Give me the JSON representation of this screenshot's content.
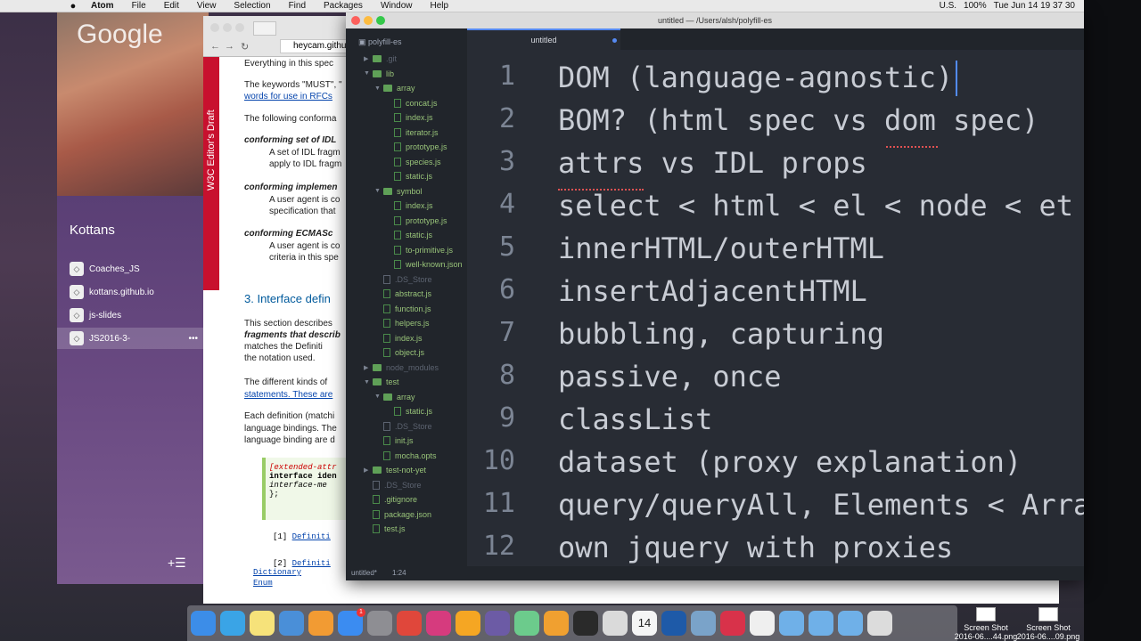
{
  "menubar": {
    "apple": "",
    "items": [
      "Atom",
      "File",
      "Edit",
      "View",
      "Selection",
      "Find",
      "Packages",
      "Window",
      "Help"
    ],
    "status": {
      "input_source": "U.S.",
      "battery": "100%",
      "datetime": "Tue Jun 14 19 37 30"
    }
  },
  "desktop": {
    "google_text": "Google"
  },
  "slack": {
    "team": "Kottans",
    "channels": [
      "Coaches_JS",
      "kottans.github.io",
      "js-slides",
      "JS2016-3-"
    ],
    "more": "•••",
    "add": "+☰"
  },
  "browser": {
    "url": "heycam.githu",
    "badge_text": "W3C Editor's Draft",
    "spec_lines": [
      {
        "t": "Everything in this spec",
        "c": ""
      },
      {
        "t": "The keywords \"MUST\", \"",
        "c": ""
      },
      {
        "t": "words for use in RFCs",
        "c": "ln"
      },
      {
        "t": "The following conforma",
        "c": ""
      },
      {
        "t": "conforming set of IDL",
        "c": "it"
      },
      {
        "t": "A set of IDL fragm",
        "c": ""
      },
      {
        "t": "apply to IDL fragm",
        "c": ""
      },
      {
        "t": "conforming implemen",
        "c": "it"
      },
      {
        "t": "A user agent is co",
        "c": ""
      },
      {
        "t": "specification that",
        "c": ""
      },
      {
        "t": "conforming ECMASc",
        "c": "it"
      },
      {
        "t": "A user agent is co",
        "c": ""
      },
      {
        "t": "criteria in this spe",
        "c": ""
      },
      {
        "t": "3. Interface defin",
        "c": "h"
      },
      {
        "t": "This section describes",
        "c": ""
      },
      {
        "t": "fragments that describ",
        "c": "it"
      },
      {
        "t": "matches the Definiti",
        "c": ""
      },
      {
        "t": "the notation used.",
        "c": ""
      },
      {
        "t": "The different kinds of",
        "c": ""
      },
      {
        "t": "statements. These are",
        "c": "ln"
      },
      {
        "t": "Each definition (matchi",
        "c": ""
      },
      {
        "t": "language bindings. The",
        "c": ""
      },
      {
        "t": "language binding are d",
        "c": ""
      }
    ],
    "code": [
      "[extended-attr",
      "interface iden",
      "  interface-me",
      "};"
    ],
    "refs": [
      {
        "n": "[1]",
        "t": "Definiti"
      },
      {
        "n": "[2]",
        "t": "Definiti"
      }
    ],
    "bottom_links": [
      "Dictionary",
      "Enum"
    ]
  },
  "atom": {
    "title": "untitled — /Users/alsh/polyfill-es",
    "tab_label": "untitled",
    "tree_root": "polyfill-es",
    "tree": [
      {
        "label": ".git",
        "kind": "dir",
        "depth": 1,
        "arrow": "▶",
        "muted": true
      },
      {
        "label": "lib",
        "kind": "dir",
        "depth": 1,
        "arrow": "▼"
      },
      {
        "label": "array",
        "kind": "dir",
        "depth": 2,
        "arrow": "▼"
      },
      {
        "label": "concat.js",
        "kind": "file",
        "depth": 3
      },
      {
        "label": "index.js",
        "kind": "file",
        "depth": 3
      },
      {
        "label": "iterator.js",
        "kind": "file",
        "depth": 3
      },
      {
        "label": "prototype.js",
        "kind": "file",
        "depth": 3
      },
      {
        "label": "species.js",
        "kind": "file",
        "depth": 3
      },
      {
        "label": "static.js",
        "kind": "file",
        "depth": 3
      },
      {
        "label": "symbol",
        "kind": "dir",
        "depth": 2,
        "arrow": "▼"
      },
      {
        "label": "index.js",
        "kind": "file",
        "depth": 3
      },
      {
        "label": "prototype.js",
        "kind": "file",
        "depth": 3
      },
      {
        "label": "static.js",
        "kind": "file",
        "depth": 3
      },
      {
        "label": "to-primitive.js",
        "kind": "file",
        "depth": 3
      },
      {
        "label": "well-known.json",
        "kind": "file",
        "depth": 3
      },
      {
        "label": ".DS_Store",
        "kind": "file",
        "depth": 2,
        "muted": true
      },
      {
        "label": "abstract.js",
        "kind": "file",
        "depth": 2
      },
      {
        "label": "function.js",
        "kind": "file",
        "depth": 2
      },
      {
        "label": "helpers.js",
        "kind": "file",
        "depth": 2
      },
      {
        "label": "index.js",
        "kind": "file",
        "depth": 2
      },
      {
        "label": "object.js",
        "kind": "file",
        "depth": 2
      },
      {
        "label": "node_modules",
        "kind": "dir",
        "depth": 1,
        "arrow": "▶",
        "muted": true
      },
      {
        "label": "test",
        "kind": "dir",
        "depth": 1,
        "arrow": "▼"
      },
      {
        "label": "array",
        "kind": "dir",
        "depth": 2,
        "arrow": "▼"
      },
      {
        "label": "static.js",
        "kind": "file",
        "depth": 3
      },
      {
        "label": ".DS_Store",
        "kind": "file",
        "depth": 2,
        "muted": true
      },
      {
        "label": "init.js",
        "kind": "file",
        "depth": 2
      },
      {
        "label": "mocha.opts",
        "kind": "file",
        "depth": 2
      },
      {
        "label": "test-not-yet",
        "kind": "dir",
        "depth": 1,
        "arrow": "▶"
      },
      {
        "label": ".DS_Store",
        "kind": "file",
        "depth": 1,
        "muted": true
      },
      {
        "label": ".gitignore",
        "kind": "file",
        "depth": 1
      },
      {
        "label": "package.json",
        "kind": "file",
        "depth": 1
      },
      {
        "label": "test.js",
        "kind": "file",
        "depth": 1
      }
    ],
    "lines": [
      {
        "n": "1",
        "text": "DOM (language-agnostic)"
      },
      {
        "n": "2",
        "text": "BOM? (html spec vs dom spec)"
      },
      {
        "n": "3",
        "text": "attrs vs IDL props"
      },
      {
        "n": "4",
        "text": "select < html < el < node < et"
      },
      {
        "n": "5",
        "text": "innerHTML/outerHTML"
      },
      {
        "n": "6",
        "text": "insertAdjacentHTML"
      },
      {
        "n": "7",
        "text": "bubbling, capturing"
      },
      {
        "n": "8",
        "text": "passive, once"
      },
      {
        "n": "9",
        "text": "classList"
      },
      {
        "n": "10",
        "text": "dataset (proxy explanation)"
      },
      {
        "n": "11",
        "text": "query/queryAll, Elements < Arra"
      },
      {
        "n": "12",
        "text": "own jquery with proxies"
      }
    ],
    "status_file": "untitled*",
    "status_pos": "1:24"
  },
  "dock": {
    "badge_count": "1",
    "calendar_day": "14",
    "files": [
      {
        "name": "Screen Shot",
        "sub": "2016-06....44.png"
      },
      {
        "name": "Screen Shot",
        "sub": "2016-06....09.png"
      }
    ],
    "icons": [
      {
        "name": "finder-icon",
        "color": "#3c8de8"
      },
      {
        "name": "safari-icon",
        "color": "#3aa4e6"
      },
      {
        "name": "notes-icon",
        "color": "#f6e27a"
      },
      {
        "name": "keynote-icon",
        "color": "#4a8fd8"
      },
      {
        "name": "ibooks-icon",
        "color": "#f29b33"
      },
      {
        "name": "app-store-icon",
        "color": "#3b8cf1"
      },
      {
        "name": "system-preferences-icon",
        "color": "#8e8e93"
      },
      {
        "name": "chrome-icon",
        "color": "#e0473b"
      },
      {
        "name": "skype-icon",
        "color": "#d63b7e"
      },
      {
        "name": "sublime-icon",
        "color": "#f5a623"
      },
      {
        "name": "github-icon",
        "color": "#6c5ba5"
      },
      {
        "name": "atom-icon",
        "color": "#6ccb8c"
      },
      {
        "name": "slides-icon",
        "color": "#f0a030"
      },
      {
        "name": "terminal-icon",
        "color": "#2a2a2a"
      },
      {
        "name": "texteditor-icon",
        "color": "#dadada"
      },
      {
        "name": "calendar-icon",
        "color": "#f5f5f5"
      },
      {
        "name": "earth-icon",
        "color": "#1e5aa8"
      },
      {
        "name": "chrome-canary-icon",
        "color": "#7aa3c9"
      },
      {
        "name": "fork-icon",
        "color": "#d8324a"
      },
      {
        "name": "document-icon",
        "color": "#efefef"
      },
      {
        "name": "folder-icon",
        "color": "#6fb0e8"
      },
      {
        "name": "folder-icon-2",
        "color": "#6fb0e8"
      },
      {
        "name": "folder-icon-3",
        "color": "#6fb0e8"
      },
      {
        "name": "trash-icon",
        "color": "#dcdcdc"
      }
    ]
  }
}
